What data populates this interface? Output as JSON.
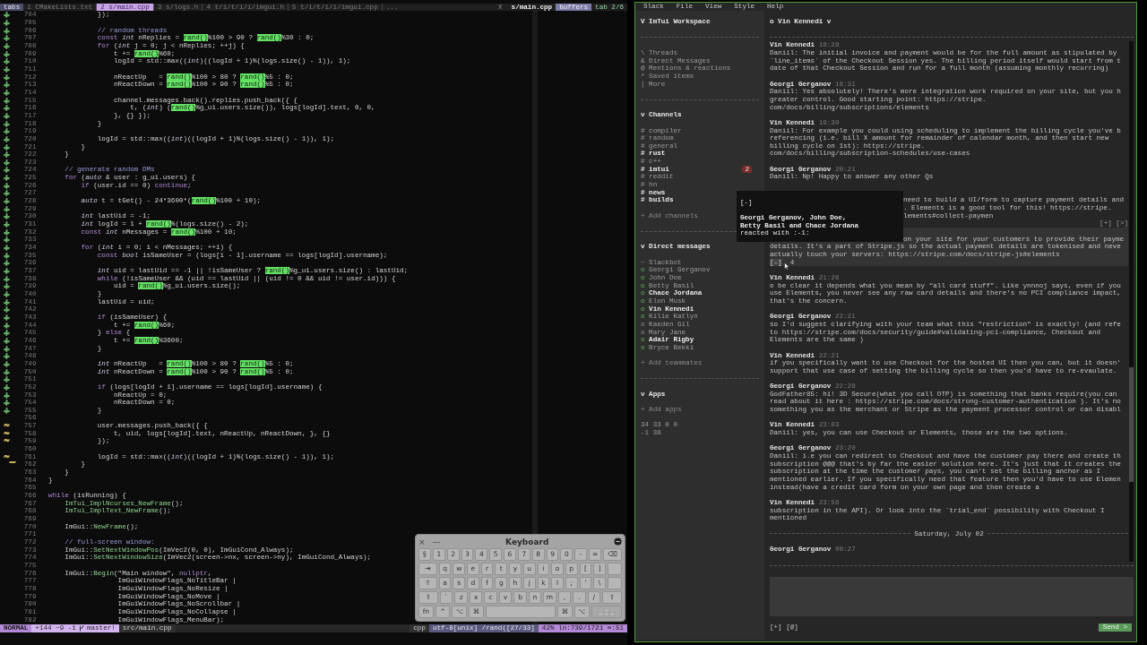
{
  "editor": {
    "tabline": {
      "label": "tabs",
      "tabs": [
        {
          "label": "1 CMakeLists.txt",
          "selected": false
        },
        {
          "label": "2 s/main.cpp",
          "selected": true
        },
        {
          "label": "3 s/logs.h",
          "selected": false
        },
        {
          "label": "4 t/i/t/i/i/imgui.h",
          "selected": false
        },
        {
          "label": "5 t/i/t/i/i/imgui.cpp",
          "selected": false
        }
      ],
      "overflow": "...",
      "close": "X",
      "buffer": "s/main.cpp",
      "buffers_label": "buffers",
      "tab_counter": "tab 2/6"
    },
    "lines": [
      {
        "number": "704",
        "sign": "+",
        "color": "#5faf5f",
        "segments": [
          {
            "kind": "code",
            "text": "              });"
          }
        ]
      },
      {
        "number": "705",
        "sign": "+",
        "color": "#5faf5f"
      },
      {
        "number": "706",
        "sign": "+",
        "color": "#5faf5f",
        "segments": [
          {
            "kind": "comment",
            "text": "              // random threads"
          }
        ]
      },
      {
        "number": "707",
        "sign": "+",
        "color": "#5faf5f",
        "segments": [
          {
            "kind": "keyword",
            "text": "              const "
          },
          {
            "kind": "type",
            "text": "int"
          },
          {
            "kind": "code",
            "text": " nReplies = "
          },
          {
            "kind": "match",
            "text": "rand()"
          },
          {
            "kind": "code",
            "text": "%100 > 90 ? "
          },
          {
            "kind": "match",
            "text": "rand()"
          },
          {
            "kind": "code",
            "text": "%30 : 0;"
          }
        ]
      },
      {
        "number": "708",
        "sign": "+",
        "color": "#5faf5f",
        "segments": [
          {
            "kind": "keyword",
            "text": "              for"
          },
          {
            "kind": "code",
            "text": " ("
          },
          {
            "kind": "type",
            "text": "int"
          },
          {
            "kind": "code",
            "text": " j = 0; j < nReplies; ++j) {"
          }
        ]
      },
      {
        "number": "709",
        "sign": "+",
        "color": "#5faf5f",
        "segments": [
          {
            "kind": "code",
            "text": "                  t += "
          },
          {
            "kind": "match",
            "text": "rand()"
          },
          {
            "kind": "code",
            "text": "%60;"
          }
        ]
      },
      {
        "number": "710",
        "sign": "+",
        "color": "#5faf5f",
        "segments": [
          {
            "kind": "code",
            "text": "                  logId = std::max(("
          },
          {
            "kind": "type",
            "text": "int"
          },
          {
            "kind": "code",
            "text": ")((logId + 1)%(logs.size() - 1)), 1);"
          }
        ]
      },
      {
        "number": "711",
        "sign": "+",
        "color": "#5faf5f"
      },
      {
        "number": "712",
        "sign": "+",
        "color": "#5faf5f",
        "segments": [
          {
            "kind": "code",
            "text": "                  nReactUp   = "
          },
          {
            "kind": "match",
            "text": "rand()"
          },
          {
            "kind": "code",
            "text": "%100 > 80 ? "
          },
          {
            "kind": "match",
            "text": "rand()"
          },
          {
            "kind": "code",
            "text": "%5 : 0;"
          }
        ]
      },
      {
        "number": "713",
        "sign": "+",
        "color": "#5faf5f",
        "segments": [
          {
            "kind": "code",
            "text": "                  nReactDown = "
          },
          {
            "kind": "match",
            "text": "rand()"
          },
          {
            "kind": "code",
            "text": "%100 > 90 ? "
          },
          {
            "kind": "match",
            "text": "rand()"
          },
          {
            "kind": "code",
            "text": "%5 : 0;"
          }
        ]
      },
      {
        "number": "714",
        "sign": "+",
        "color": "#5faf5f"
      },
      {
        "number": "715",
        "sign": "+",
        "color": "#5faf5f",
        "segments": [
          {
            "kind": "code",
            "text": "                  channel.messages.back().replies.push_back({ {"
          }
        ]
      },
      {
        "number": "716",
        "sign": "+",
        "color": "#5faf5f",
        "segments": [
          {
            "kind": "code",
            "text": "                      t, ("
          },
          {
            "kind": "type",
            "text": "int"
          },
          {
            "kind": "code",
            "text": ") ("
          },
          {
            "kind": "match",
            "text": "rand()"
          },
          {
            "kind": "code",
            "text": "%g_ui.users.size()), logs[logId].text, 0, 0,"
          }
        ]
      },
      {
        "number": "717",
        "sign": "+",
        "color": "#5faf5f",
        "segments": [
          {
            "kind": "code",
            "text": "                  }, {} });"
          }
        ]
      },
      {
        "number": "718",
        "sign": "+",
        "color": "#5faf5f",
        "segments": [
          {
            "kind": "code",
            "text": "              }"
          }
        ]
      },
      {
        "number": "719",
        "sign": "+",
        "color": "#5faf5f"
      },
      {
        "number": "720",
        "sign": "+",
        "color": "#5faf5f",
        "segments": [
          {
            "kind": "code",
            "text": "              logId = std::max(("
          },
          {
            "kind": "type",
            "text": "int"
          },
          {
            "kind": "code",
            "text": ")((logId + 1)%(logs.size() - 1)), 1);"
          }
        ]
      },
      {
        "number": "721",
        "sign": "+",
        "color": "#5faf5f",
        "segments": [
          {
            "kind": "code",
            "text": "          }"
          }
        ]
      },
      {
        "number": "722",
        "sign": "+",
        "color": "#5faf5f",
        "segments": [
          {
            "kind": "code",
            "text": "      }"
          }
        ]
      },
      {
        "number": "723",
        "sign": "+",
        "color": "#5faf5f"
      },
      {
        "number": "724",
        "sign": "+",
        "color": "#5faf5f",
        "segments": [
          {
            "kind": "comment",
            "text": "      // generate random DMs"
          }
        ]
      },
      {
        "number": "725",
        "sign": "+",
        "color": "#5faf5f",
        "segments": [
          {
            "kind": "keyword",
            "text": "      for"
          },
          {
            "kind": "code",
            "text": " ("
          },
          {
            "kind": "type",
            "text": "auto"
          },
          {
            "kind": "code",
            "text": " & user : g_ui.users) {"
          }
        ]
      },
      {
        "number": "726",
        "sign": "+",
        "color": "#5faf5f",
        "segments": [
          {
            "kind": "keyword",
            "text": "          if"
          },
          {
            "kind": "code",
            "text": " (user.id == 0) "
          },
          {
            "kind": "keyword",
            "text": "continue"
          },
          {
            "kind": "code",
            "text": ";"
          }
        ]
      },
      {
        "number": "727",
        "sign": "+",
        "color": "#5faf5f"
      },
      {
        "number": "728",
        "sign": "+",
        "color": "#5faf5f",
        "segments": [
          {
            "kind": "type",
            "text": "          auto"
          },
          {
            "kind": "code",
            "text": " t = tGet() - 24*3600*("
          },
          {
            "kind": "match",
            "text": "rand()"
          },
          {
            "kind": "code",
            "text": "%100 + 10);"
          }
        ]
      },
      {
        "number": "729",
        "sign": "+",
        "color": "#5faf5f"
      },
      {
        "number": "730",
        "sign": "+",
        "color": "#5faf5f",
        "segments": [
          {
            "kind": "type",
            "text": "          int"
          },
          {
            "kind": "code",
            "text": " lastUid = -1;"
          }
        ]
      },
      {
        "number": "731",
        "sign": "+",
        "color": "#5faf5f",
        "segments": [
          {
            "kind": "type",
            "text": "          int"
          },
          {
            "kind": "code",
            "text": " logId = 1 + "
          },
          {
            "kind": "match",
            "text": "rand()"
          },
          {
            "kind": "code",
            "text": "%(logs.size() - 2);"
          }
        ]
      },
      {
        "number": "732",
        "sign": "+",
        "color": "#5faf5f",
        "segments": [
          {
            "kind": "keyword",
            "text": "          const "
          },
          {
            "kind": "type",
            "text": "int"
          },
          {
            "kind": "code",
            "text": " nMessages = "
          },
          {
            "kind": "match",
            "text": "rand()"
          },
          {
            "kind": "code",
            "text": "%100 + 10;"
          }
        ]
      },
      {
        "number": "733",
        "sign": "+",
        "color": "#5faf5f"
      },
      {
        "number": "734",
        "sign": "+",
        "color": "#5faf5f",
        "segments": [
          {
            "kind": "keyword",
            "text": "          for"
          },
          {
            "kind": "code",
            "text": " ("
          },
          {
            "kind": "type",
            "text": "int"
          },
          {
            "kind": "code",
            "text": " i = 0; i < nMessages; ++i) {"
          }
        ]
      },
      {
        "number": "735",
        "sign": "+",
        "color": "#5faf5f",
        "segments": [
          {
            "kind": "keyword",
            "text": "              const "
          },
          {
            "kind": "type",
            "text": "bool"
          },
          {
            "kind": "code",
            "text": " isSameUser = (logs[i - 1].username == logs[logId].username);"
          }
        ]
      },
      {
        "number": "736",
        "sign": "+",
        "color": "#5faf5f"
      },
      {
        "number": "737",
        "sign": "+",
        "color": "#5faf5f",
        "segments": [
          {
            "kind": "type",
            "text": "              int"
          },
          {
            "kind": "code",
            "text": " uid = lastUid == -1 || !isSameUser ? "
          },
          {
            "kind": "match",
            "text": "rand()"
          },
          {
            "kind": "code",
            "text": "%g_ui.users.size() : lastUid;"
          }
        ]
      },
      {
        "number": "738",
        "sign": "+",
        "color": "#5faf5f",
        "segments": [
          {
            "kind": "keyword",
            "text": "              while"
          },
          {
            "kind": "code",
            "text": " (!isSameUser && (uid == lastUid || (uid != 0 && uid != user.id))) {"
          }
        ]
      },
      {
        "number": "739",
        "sign": "+",
        "color": "#5faf5f",
        "segments": [
          {
            "kind": "code",
            "text": "                  uid = "
          },
          {
            "kind": "match",
            "text": "rand()"
          },
          {
            "kind": "code",
            "text": "%g_ui.users.size();"
          }
        ]
      },
      {
        "number": "740",
        "sign": "+",
        "color": "#5faf5f",
        "segments": [
          {
            "kind": "code",
            "text": "              }"
          }
        ]
      },
      {
        "number": "741",
        "sign": "+",
        "color": "#5faf5f",
        "segments": [
          {
            "kind": "code",
            "text": "              lastUid = uid;"
          }
        ]
      },
      {
        "number": "742",
        "sign": "+",
        "color": "#5faf5f"
      },
      {
        "number": "743",
        "sign": "+",
        "color": "#5faf5f",
        "segments": [
          {
            "kind": "keyword",
            "text": "              if"
          },
          {
            "kind": "code",
            "text": " (isSameUser) {"
          }
        ]
      },
      {
        "number": "744",
        "sign": "+",
        "color": "#5faf5f",
        "segments": [
          {
            "kind": "code",
            "text": "                  t += "
          },
          {
            "kind": "match",
            "text": "rand()"
          },
          {
            "kind": "code",
            "text": "%60;"
          }
        ]
      },
      {
        "number": "745",
        "sign": "+",
        "color": "#5faf5f",
        "segments": [
          {
            "kind": "code",
            "text": "              } "
          },
          {
            "kind": "keyword",
            "text": "else"
          },
          {
            "kind": "code",
            "text": " {"
          }
        ]
      },
      {
        "number": "746",
        "sign": "+",
        "color": "#5faf5f",
        "segments": [
          {
            "kind": "code",
            "text": "                  t += "
          },
          {
            "kind": "match",
            "text": "rand()"
          },
          {
            "kind": "code",
            "text": "%3600;"
          }
        ]
      },
      {
        "number": "747",
        "sign": "+",
        "color": "#5faf5f",
        "segments": [
          {
            "kind": "code",
            "text": "              }"
          }
        ]
      },
      {
        "number": "748",
        "sign": "+",
        "color": "#5faf5f"
      },
      {
        "number": "749",
        "sign": "+",
        "color": "#5faf5f",
        "segments": [
          {
            "kind": "type",
            "text": "              int"
          },
          {
            "kind": "code",
            "text": " nReactUp   = "
          },
          {
            "kind": "match",
            "text": "rand()"
          },
          {
            "kind": "code",
            "text": "%100 > 80 ? "
          },
          {
            "kind": "match",
            "text": "rand()"
          },
          {
            "kind": "code",
            "text": "%5 : 0;"
          }
        ]
      },
      {
        "number": "750",
        "sign": "+",
        "color": "#5faf5f",
        "segments": [
          {
            "kind": "type",
            "text": "              int"
          },
          {
            "kind": "code",
            "text": " nReactDown = "
          },
          {
            "kind": "match",
            "text": "rand()"
          },
          {
            "kind": "code",
            "text": "%100 > 90 ? "
          },
          {
            "kind": "match",
            "text": "rand()"
          },
          {
            "kind": "code",
            "text": "%5 : 0;"
          }
        ]
      },
      {
        "number": "751",
        "sign": "+",
        "color": "#5faf5f"
      },
      {
        "number": "752",
        "sign": "+",
        "color": "#5faf5f",
        "segments": [
          {
            "kind": "keyword",
            "text": "              if"
          },
          {
            "kind": "code",
            "text": " (logs[logId + 1].username == logs[logId].username) {"
          }
        ]
      },
      {
        "number": "753",
        "sign": "+",
        "color": "#5faf5f",
        "segments": [
          {
            "kind": "code",
            "text": "                  nReactUp = 0;"
          }
        ]
      },
      {
        "number": "754",
        "sign": "+",
        "color": "#5faf5f",
        "segments": [
          {
            "kind": "code",
            "text": "                  nReactDown = 0;"
          }
        ]
      },
      {
        "number": "755",
        "sign": "+",
        "color": "#5faf5f",
        "segments": [
          {
            "kind": "code",
            "text": "              }"
          }
        ]
      },
      {
        "number": "756"
      },
      {
        "number": "757",
        "sign": "~",
        "color": "#c8b45a",
        "segments": [
          {
            "kind": "code",
            "text": "              user.messages.push_back({ {"
          }
        ]
      },
      {
        "number": "758",
        "sign": "~",
        "color": "#c8b45a",
        "segments": [
          {
            "kind": "code",
            "text": "                  t, uid, logs[logId].text, nReactUp, nReactDown, }, {}"
          }
        ]
      },
      {
        "number": "759",
        "sign": "~",
        "color": "#c8b45a",
        "segments": [
          {
            "kind": "code",
            "text": "              });"
          }
        ]
      },
      {
        "number": "760"
      },
      {
        "number": "761",
        "sign": "~_",
        "color": "#c8b45a",
        "segments": [
          {
            "kind": "code",
            "text": "              logId = std::max(("
          },
          {
            "kind": "type",
            "text": "int"
          },
          {
            "kind": "code",
            "text": ")((logId + 1)%(logs.size() - 1)), 1);"
          }
        ]
      },
      {
        "number": "762",
        "segments": [
          {
            "kind": "code",
            "text": "          }"
          }
        ]
      },
      {
        "number": "763",
        "segments": [
          {
            "kind": "code",
            "text": "      }"
          }
        ]
      },
      {
        "number": "764",
        "segments": [
          {
            "kind": "code",
            "text": "  }"
          }
        ]
      },
      {
        "number": "765"
      },
      {
        "number": "766",
        "segments": [
          {
            "kind": "keyword",
            "text": "  while"
          },
          {
            "kind": "code",
            "text": " (isRunning) {"
          }
        ]
      },
      {
        "number": "767",
        "segments": [
          {
            "kind": "call",
            "text": "      ImTui_ImplNcurses_NewFrame"
          },
          {
            "kind": "code",
            "text": "();"
          }
        ]
      },
      {
        "number": "768",
        "segments": [
          {
            "kind": "call",
            "text": "      ImTui_ImplText_NewFrame"
          },
          {
            "kind": "code",
            "text": "();"
          }
        ]
      },
      {
        "number": "769"
      },
      {
        "number": "770",
        "segments": [
          {
            "kind": "code",
            "text": "      ImGui::"
          },
          {
            "kind": "call",
            "text": "NewFrame"
          },
          {
            "kind": "code",
            "text": "();"
          }
        ]
      },
      {
        "number": "771"
      },
      {
        "number": "772",
        "segments": [
          {
            "kind": "comment",
            "text": "      // full-screen window:"
          }
        ]
      },
      {
        "number": "773",
        "segments": [
          {
            "kind": "code",
            "text": "      ImGui::"
          },
          {
            "kind": "call",
            "text": "SetNextWindowPos"
          },
          {
            "kind": "code",
            "text": "(ImVec2(0, 0), ImGuiCond_Always);"
          }
        ]
      },
      {
        "number": "774",
        "segments": [
          {
            "kind": "code",
            "text": "      ImGui::"
          },
          {
            "kind": "call",
            "text": "SetNextWindowSize"
          },
          {
            "kind": "code",
            "text": "(ImVec2(screen->nx, screen->ny), ImGuiCond_Always);"
          }
        ]
      },
      {
        "number": "775"
      },
      {
        "number": "776",
        "segments": [
          {
            "kind": "code",
            "text": "      ImGui::"
          },
          {
            "kind": "call",
            "text": "Begin"
          },
          {
            "kind": "code",
            "text": "(\"Main window\", "
          },
          {
            "kind": "keyword",
            "text": "nullptr"
          },
          {
            "kind": "code",
            "text": ","
          }
        ]
      },
      {
        "number": "777",
        "segments": [
          {
            "kind": "code",
            "text": "                   ImGuiWindowFlags_NoTitleBar |"
          }
        ]
      },
      {
        "number": "778",
        "segments": [
          {
            "kind": "code",
            "text": "                   ImGuiWindowFlags_NoResize |"
          }
        ]
      },
      {
        "number": "779",
        "segments": [
          {
            "kind": "code",
            "text": "                   ImGuiWindowFlags_NoMove |"
          }
        ]
      },
      {
        "number": "780",
        "segments": [
          {
            "kind": "code",
            "text": "                   ImGuiWindowFlags_NoScrollbar |"
          }
        ]
      },
      {
        "number": "781",
        "segments": [
          {
            "kind": "code",
            "text": "                   ImGuiWindowFlags_NoCollapse |"
          }
        ]
      },
      {
        "number": "782",
        "segments": [
          {
            "kind": "code",
            "text": "                   ImGuiWindowFlags_MenuBar);"
          }
        ]
      }
    ],
    "statusline": {
      "mode": "NORMAL",
      "diff": "+144 ~9 -1",
      "branch": "master!",
      "file": "src/main.cpp",
      "filetype": "cpp",
      "encoding": "utf-8[unix]",
      "search": "/rand([27/33]",
      "percent": "42%",
      "position": "ln:739/1721",
      "column": "≡:51"
    }
  },
  "keyboard": {
    "title": "Keyboard",
    "close": "×",
    "minimize": "—",
    "key_rows": [
      {
        "keys": [
          {
            "kind": "char",
            "label": "§"
          },
          {
            "kind": "char",
            "label": "1"
          },
          {
            "kind": "char",
            "label": "2"
          },
          {
            "kind": "char",
            "label": "3"
          },
          {
            "kind": "char",
            "label": "4"
          },
          {
            "kind": "char",
            "label": "5"
          },
          {
            "kind": "char",
            "label": "6"
          },
          {
            "kind": "char",
            "label": "7"
          },
          {
            "kind": "char",
            "label": "8"
          },
          {
            "kind": "char",
            "label": "9"
          },
          {
            "kind": "char",
            "label": "0"
          },
          {
            "kind": "char",
            "label": "-"
          },
          {
            "kind": "char",
            "label": "="
          },
          {
            "kind": "wide",
            "label": "⌫"
          }
        ]
      },
      {
        "keys": [
          {
            "kind": "wide",
            "label": "⇥"
          },
          {
            "kind": "char",
            "label": "q"
          },
          {
            "kind": "char",
            "label": "w"
          },
          {
            "kind": "char",
            "label": "e"
          },
          {
            "kind": "char",
            "label": "r"
          },
          {
            "kind": "char",
            "label": "t"
          },
          {
            "kind": "char",
            "label": "y"
          },
          {
            "kind": "char",
            "label": "u"
          },
          {
            "kind": "char",
            "label": "i"
          },
          {
            "kind": "char",
            "label": "o"
          },
          {
            "kind": "char",
            "label": "p"
          },
          {
            "kind": "char",
            "label": "["
          },
          {
            "kind": "char",
            "label": "]"
          },
          {
            "kind": "return"
          }
        ]
      },
      {
        "keys": [
          {
            "kind": "wide",
            "label": "⇪"
          },
          {
            "kind": "char",
            "label": "a"
          },
          {
            "kind": "char",
            "label": "s"
          },
          {
            "kind": "char",
            "label": "d"
          },
          {
            "kind": "char",
            "label": "f"
          },
          {
            "kind": "char",
            "label": "g"
          },
          {
            "kind": "char",
            "label": "h"
          },
          {
            "kind": "char",
            "label": "j"
          },
          {
            "kind": "char",
            "label": "k"
          },
          {
            "kind": "char",
            "label": "l"
          },
          {
            "kind": "char",
            "label": ";"
          },
          {
            "kind": "char",
            "label": "'"
          },
          {
            "kind": "char",
            "label": "\\"
          },
          {
            "kind": "return"
          }
        ]
      },
      {
        "keys": [
          {
            "kind": "wide",
            "label": "⇧"
          },
          {
            "kind": "char",
            "label": "`"
          },
          {
            "kind": "char",
            "label": "z"
          },
          {
            "kind": "char",
            "label": "x"
          },
          {
            "kind": "char",
            "label": "c"
          },
          {
            "kind": "char",
            "label": "v"
          },
          {
            "kind": "char",
            "label": "b"
          },
          {
            "kind": "char",
            "label": "n"
          },
          {
            "kind": "char",
            "label": "m"
          },
          {
            "kind": "char",
            "label": ","
          },
          {
            "kind": "char",
            "label": "."
          },
          {
            "kind": "char",
            "label": "/"
          },
          {
            "kind": "wide",
            "label": "⇧"
          }
        ]
      },
      {
        "keys": [
          {
            "kind": "char",
            "label": "fn"
          },
          {
            "kind": "char",
            "label": "^"
          },
          {
            "kind": "char",
            "label": "⌥"
          },
          {
            "kind": "char",
            "label": "⌘"
          },
          {
            "kind": "space"
          },
          {
            "kind": "char",
            "label": "⌘"
          },
          {
            "kind": "char",
            "label": "⌥"
          },
          {
            "kind": "arrows"
          }
        ]
      }
    ]
  },
  "chat": {
    "menu": [
      "Slack",
      "File",
      "View",
      "Style",
      "Help"
    ],
    "sidebar": {
      "workspace": "V ImTui Workspace",
      "nav": [
        "\\ Threads",
        "& Direct Messages",
        "@ Mentions & reactions",
        "* Saved items",
        "| More"
      ],
      "channels": {
        "title": "v Channels",
        "items": [
          {
            "label": "# compiler",
            "unread": false
          },
          {
            "label": "# random",
            "unread": false
          },
          {
            "label": "# general",
            "unread": false
          },
          {
            "label": "# rust",
            "unread": true
          },
          {
            "label": "# c++",
            "unread": false
          },
          {
            "label": "# imtui",
            "unread": true,
            "badge": "2"
          },
          {
            "label": "# reddit",
            "unread": false
          },
          {
            "label": "# hn",
            "unread": false
          },
          {
            "label": "# news",
            "unread": true
          },
          {
            "label": "# builds",
            "unread": true
          }
        ],
        "add": "+ Add channels"
      },
      "direct_messages": {
        "title": "v Direct messages",
        "items": [
          {
            "marker": "~",
            "name": "Slackbot",
            "online": false,
            "unread": false
          },
          {
            "marker": "o",
            "name": "Georgi Gerganov",
            "online": true,
            "unread": false
          },
          {
            "marker": "o",
            "name": "John Doe",
            "online": true,
            "unread": false
          },
          {
            "marker": "o",
            "name": "Betty Basil",
            "online": true,
            "unread": false
          },
          {
            "marker": "o",
            "name": "Chace Jordana",
            "online": true,
            "unread": true
          },
          {
            "marker": "o",
            "name": "Elon Musk",
            "online": true,
            "unread": false
          },
          {
            "marker": "o",
            "name": "Vin Kennedi",
            "online": true,
            "unread": true
          },
          {
            "marker": "o",
            "name": "Kilie Katlyn",
            "online": true,
            "unread": false
          },
          {
            "marker": "o",
            "name": "Kaeden Gil",
            "online": false,
            "unread": false
          },
          {
            "marker": "o",
            "name": "Mary Jane",
            "online": false,
            "unread": false
          },
          {
            "marker": "o",
            "name": "Adair Rigby",
            "online": true,
            "unread": true
          },
          {
            "marker": "o",
            "name": "Bryce Bekki",
            "online": true,
            "unread": false
          }
        ],
        "add": "+ Add teammates"
      },
      "apps": {
        "title": "v Apps",
        "add": "+ Add apps"
      },
      "stats": [
        "34 33 0 0",
        "-1 38"
      ]
    },
    "conversation": {
      "title": "o Vin Kennedi v",
      "messages": [
        {
          "kind": "message",
          "author": "Vin Kennedi",
          "time": "18:28",
          "hovered": false,
          "lines": [
            "Daniil: The initial invoice and payment would be for the full amount as stipulated by",
            "`line_items` of the Checkout Session yes. The billing period itself would start from t",
            "date of that Checkout Session and run for a full month (assuming monthly recurring)"
          ]
        },
        {
          "kind": "message",
          "author": "Georgi Gerganov",
          "time": "18:31",
          "hovered": false,
          "lines": [
            "Daniil: Yes absolutely! There's more integration work required on your site, but you h",
            "greater control. Good starting point: https://stripe.",
            "com/docs/billing/subscriptions/elements"
          ]
        },
        {
          "kind": "message",
          "author": "Vin Kennedi",
          "time": "19:30",
          "hovered": false,
          "lines": [
            "Daniil: For example you could using scheduling to implement the billing cycle you've b",
            "referencing (i.e. bill X amount for remainder of calendar month, and then start new",
            "billing cycle on 1st): https://stripe.",
            "com/docs/billing/subscription-schedules/use-cases"
          ]
        },
        {
          "kind": "message",
          "author": "Georgi Gerganov",
          "time": "20:21",
          "hovered": false,
          "lines": [
            "Daniil: Np! Happy to answer any other Qs"
          ]
        },
        {
          "kind": "message",
          "hovered": false,
          "partial_lines": [
            "need to build a UI/form to capture payment details and",
            ". Elements is a good tool for this! https://stripe.",
            "lements#collect-paymen"
          ],
          "actions": [
            "[+]",
            "[>]"
          ]
        },
        {
          "kind": "message",
          "hovered": true,
          "partial_lines": [
            "on your site for your customers to provide their payme"
          ],
          "lines": [
            "details. It's a part of Stripe.js so the actual payment details are tokenised and neve",
            "actually touch your servers: https://stripe.com/docs/stripe-js#elements"
          ],
          "reaction": {
            "toggle": "[-]",
            "count": "4"
          }
        },
        {
          "kind": "message",
          "author": "Vin Kennedi",
          "time": "21:26",
          "hovered": false,
          "lines": [
            "o be clear it depends what you mean by “all card stuff”. Like ynnnoj says, even if you",
            "use Elements, you never see any raw card details and there's no PCI compliance impact,",
            "that's the concern."
          ]
        },
        {
          "kind": "message",
          "author": "Georgi Gerganov",
          "time": "22:21",
          "hovered": false,
          "lines": [
            "so I'd suggest clarifying with your team what this \"restriction\" is exactly! (and refe",
            "to https://stripe.com/docs/security/guide#validating-pci-compliance, Checkout and",
            "Elements are the same )"
          ]
        },
        {
          "kind": "message",
          "author": "Vin Kennedi",
          "time": "22:21",
          "hovered": false,
          "lines": [
            "if you specifically want to use Checkout for the hosted UI then you can, but it doesn'",
            "support that use case of setting the billing cycle so then you'd have to re-evaulate."
          ]
        },
        {
          "kind": "message",
          "author": "Georgi Gerganov",
          "time": "22:28",
          "hovered": false,
          "lines": [
            "GodFather85: hi! 3D Secure(what you call OTP) is something that banks require(you can",
            "read about it here : https://stripe.com/docs/strong-customer-authentication ). It's no",
            "something you as the merchant or Stripe as the payment processor control or can disabl"
          ]
        },
        {
          "kind": "message",
          "author": "Vin Kennedi",
          "time": "23:03",
          "hovered": false,
          "lines": [
            "Daniil: yes, you can use Checkout or Elements, those are the two options."
          ]
        },
        {
          "kind": "message",
          "author": "Georgi Gerganov",
          "time": "23:20",
          "hovered": false,
          "lines": [
            "Daniil: i.e you can redirect to Checkout and have the customer pay there and create th",
            "subscription @@@ that's by far the easier solution here. It's just that it creates the",
            "subscription at the time the customer pays, you can't set the billing anchor as I",
            "mentioned earlier. If you specifically need that feature then you'd have to use Elemen",
            "instead(have a credit card form on your own page and then create a"
          ]
        },
        {
          "kind": "message",
          "author": "Vin Kennedi",
          "time": "23:56",
          "hovered": false,
          "lines": [
            "subscription in the API). Or look into the `trial_end` possibility with Checkout I",
            "mentioned"
          ]
        },
        {
          "kind": "divider",
          "label": "Saturday, July 02"
        },
        {
          "kind": "message",
          "author": "Georgi Gerganov",
          "time": "00:27",
          "hovered": false
        }
      ],
      "composer": {
        "attach": "[+]",
        "mention": "[@]",
        "send": "Send >"
      }
    },
    "reaction_popup": {
      "toggle": "[-]",
      "names": [
        "Georgi Gerganov, John Doe,",
        "Betty Basil and Chace Jordana"
      ],
      "caption": "reacted with :-1:"
    }
  }
}
